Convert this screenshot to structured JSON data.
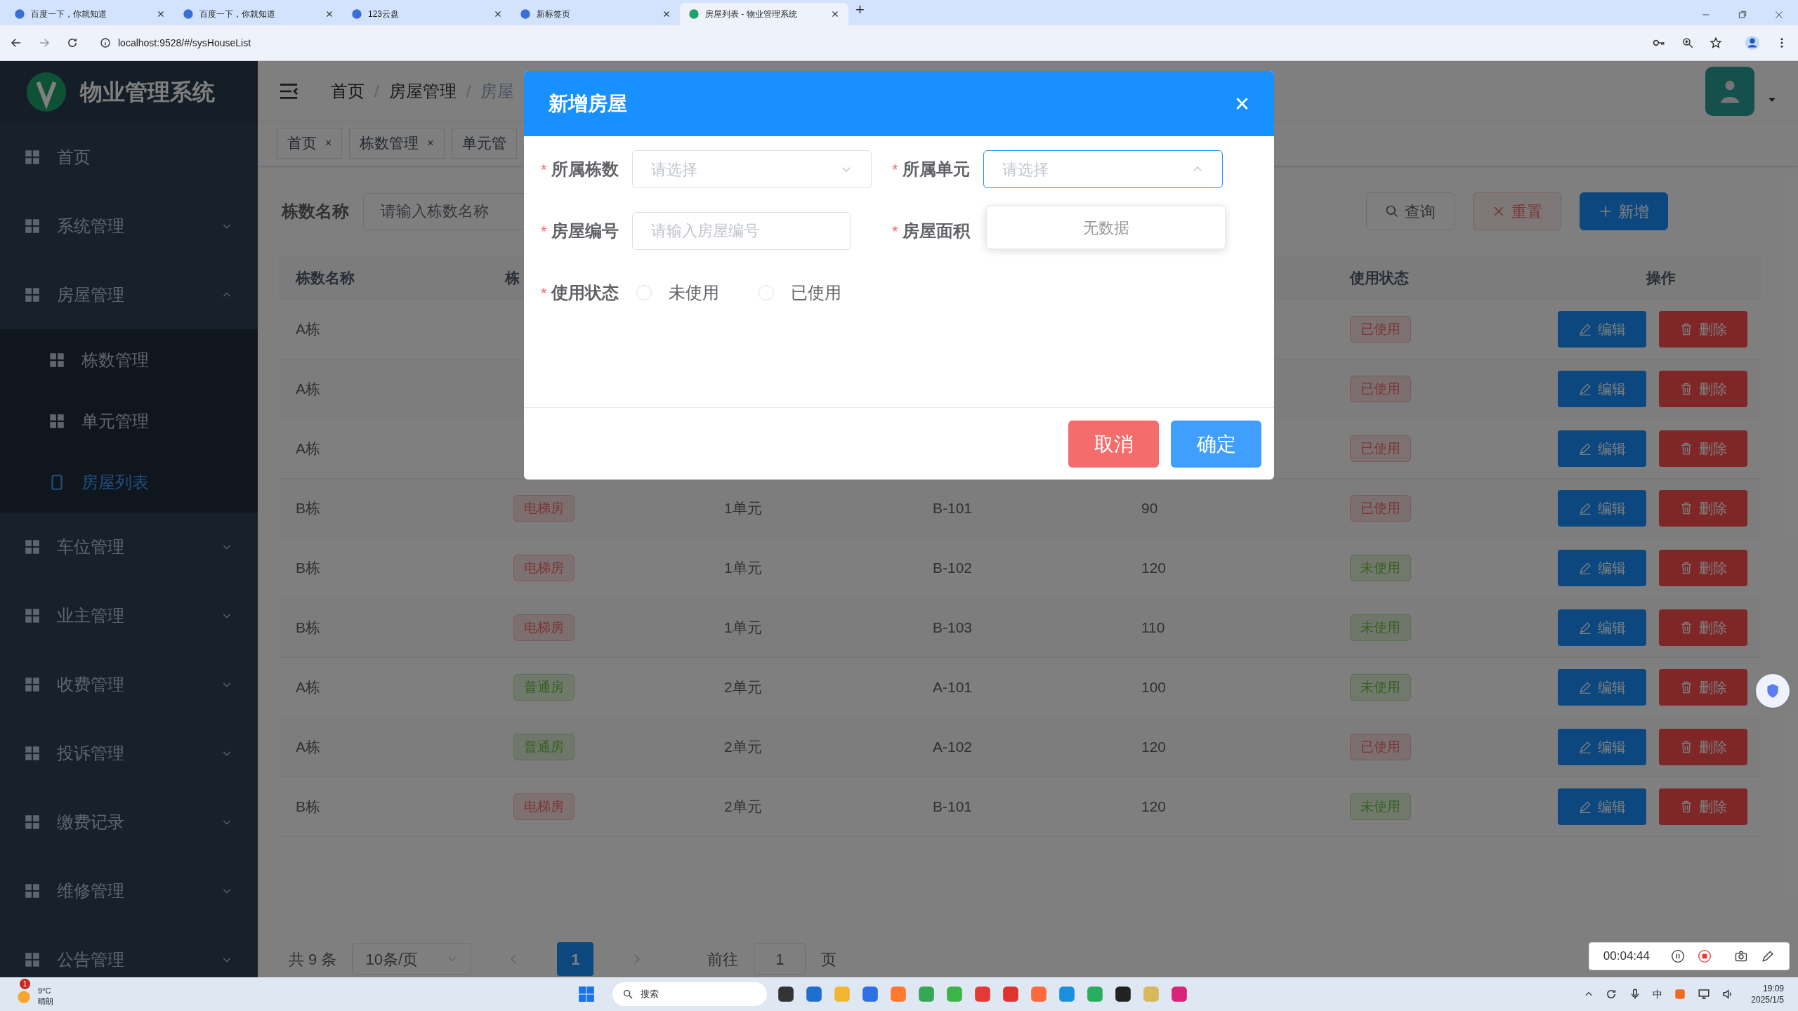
{
  "browser": {
    "tabs": [
      {
        "title": "百度一下，你就知道",
        "selected": false
      },
      {
        "title": "百度一下，你就知道",
        "selected": false
      },
      {
        "title": "123云盘",
        "selected": false
      },
      {
        "title": "新标签页",
        "selected": false
      },
      {
        "title": "房屋列表 - 物业管理系统",
        "selected": true
      }
    ],
    "new_tab": "+",
    "url": "localhost:9528/#/sysHouseList"
  },
  "sidebar": {
    "title": "物业管理系统",
    "items": [
      {
        "label": "首页",
        "selected": false
      },
      {
        "label": "系统管理",
        "expanded": false
      },
      {
        "label": "房屋管理",
        "expanded": true,
        "children": [
          {
            "label": "栋数管理",
            "selected": false
          },
          {
            "label": "单元管理",
            "selected": false
          },
          {
            "label": "房屋列表",
            "selected": true
          }
        ]
      },
      {
        "label": "车位管理",
        "expanded": false
      },
      {
        "label": "业主管理",
        "expanded": false
      },
      {
        "label": "收费管理",
        "expanded": false
      },
      {
        "label": "投诉管理",
        "expanded": false
      },
      {
        "label": "缴费记录",
        "expanded": false
      },
      {
        "label": "维修管理",
        "expanded": false
      },
      {
        "label": "公告管理",
        "expanded": false
      }
    ]
  },
  "breadcrumb": {
    "items": [
      "首页",
      "房屋管理",
      "房屋"
    ],
    "separators": [
      "/",
      "/"
    ]
  },
  "tags": [
    {
      "label": "首页",
      "close": "×"
    },
    {
      "label": "栋数管理",
      "close": "×"
    },
    {
      "label": "单元管"
    }
  ],
  "search": {
    "label": "栋数名称",
    "placeholder": "请输入栋数名称",
    "buttons": [
      {
        "label": "查询",
        "kind": "query"
      },
      {
        "label": "重置",
        "kind": "reset"
      },
      {
        "label": "新增",
        "kind": "add"
      }
    ]
  },
  "table": {
    "headers": {
      "name": "栋数名称",
      "type": "栋",
      "status": "使用状态",
      "actions": "操作"
    },
    "rows": [
      {
        "name": "A栋",
        "status": {
          "label": "已使用",
          "color": "#7b3636"
        },
        "edit": "编辑",
        "delete": "删除"
      },
      {
        "name": "A栋",
        "status": {
          "label": "已使用",
          "color": "#7b3636"
        },
        "edit": "编辑",
        "delete": "删除"
      },
      {
        "name": "A栋",
        "status": {
          "label": "已使用",
          "color": "#7b3636"
        },
        "edit": "编辑",
        "delete": "删除"
      },
      {
        "name": "B栋",
        "type": {
          "label": "电梯房",
          "color": "#7b3636"
        },
        "unit": "1单元",
        "number": "B-101",
        "area": "90",
        "status": {
          "label": "已使用",
          "color": "#7b3636"
        },
        "edit": "编辑",
        "delete": "删除"
      },
      {
        "name": "B栋",
        "type": {
          "label": "电梯房",
          "color": "#7b3636"
        },
        "unit": "1单元",
        "number": "B-102",
        "area": "120",
        "status": {
          "label": "未使用",
          "color": "#33611d"
        },
        "edit": "编辑",
        "delete": "删除"
      },
      {
        "name": "B栋",
        "type": {
          "label": "电梯房",
          "color": "#7b3636"
        },
        "unit": "1单元",
        "number": "B-103",
        "area": "110",
        "status": {
          "label": "未使用",
          "color": "#33611d"
        },
        "edit": "编辑",
        "delete": "删除"
      },
      {
        "name": "A栋",
        "type": {
          "label": "普通房",
          "color": "#33611d"
        },
        "unit": "2单元",
        "number": "A-101",
        "area": "100",
        "status": {
          "label": "未使用",
          "color": "#33611d"
        },
        "edit": "编辑",
        "delete": "删除"
      },
      {
        "name": "A栋",
        "type": {
          "label": "普通房",
          "color": "#33611d"
        },
        "unit": "2单元",
        "number": "A-102",
        "area": "120",
        "status": {
          "label": "已使用",
          "color": "#7b3636"
        },
        "edit": "编辑",
        "delete": "删除"
      },
      {
        "name": "B栋",
        "type": {
          "label": "电梯房",
          "color": "#7b3636"
        },
        "unit": "2单元",
        "number": "B-101",
        "area": "120",
        "status": {
          "label": "未使用",
          "color": "#33611d"
        },
        "edit": "编辑",
        "delete": "删除"
      }
    ]
  },
  "pagination": {
    "total": "共 9 条",
    "page_size": "10条/页",
    "pages": [
      {
        "label": "1",
        "selected": true
      }
    ],
    "goto": "前往",
    "goto_value": "1",
    "page_word": "页"
  },
  "dialog": {
    "title": "新增房屋",
    "close": "×",
    "fields": [
      {
        "kind": "select",
        "required_mark": "*",
        "label": "所属栋数",
        "placeholder": "请选择",
        "focused": false
      },
      {
        "kind": "select",
        "required_mark": "*",
        "label": "所属单元",
        "placeholder": "请选择",
        "focused": true
      },
      {
        "kind": "input",
        "required_mark": "*",
        "label": "房屋编号",
        "placeholder": "请输入房屋编号"
      },
      {
        "kind": "hidden",
        "required_mark": "*",
        "label": "房屋面积"
      },
      {
        "kind": "radio",
        "required_mark": "*",
        "label": "使用状态",
        "options": [
          {
            "label": "未使用",
            "selected": false
          },
          {
            "label": "已使用",
            "selected": false
          }
        ]
      }
    ],
    "dropdown": "无数据",
    "cancel": "取消",
    "confirm": "确定"
  },
  "recorder": {
    "time": "00:04:44"
  },
  "taskbar": {
    "weather_badge": "1",
    "temperature": "9°C",
    "weather": "晴朗",
    "search": "搜索",
    "ime": "中",
    "time": "19:09",
    "date": "2025/1/5"
  }
}
